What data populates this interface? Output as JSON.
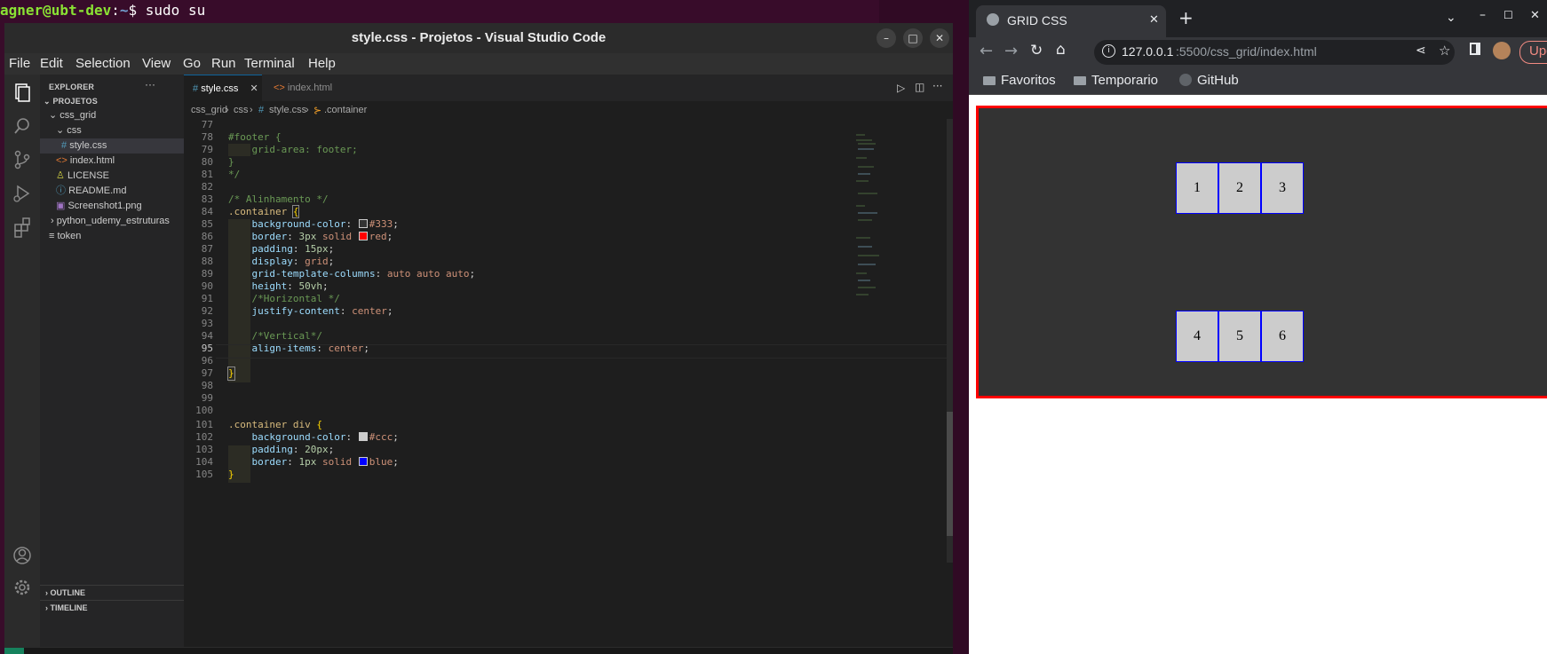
{
  "terminal": {
    "user": "agner@ubt-dev",
    "path": "~",
    "prompt_tail": "$ sudo su"
  },
  "vscode": {
    "title": "style.css - Projetos - Visual Studio Code",
    "menu": [
      "File",
      "Edit",
      "Selection",
      "View",
      "Go",
      "Run",
      "Terminal",
      "Help"
    ],
    "explorer_title": "EXPLORER",
    "workspace": "PROJETOS",
    "tree": [
      {
        "label": "css_grid",
        "kind": "folder-open"
      },
      {
        "label": "css",
        "kind": "folder-open"
      },
      {
        "label": "style.css",
        "kind": "css"
      },
      {
        "label": "index.html",
        "kind": "html"
      },
      {
        "label": "LICENSE",
        "kind": "license"
      },
      {
        "label": "README.md",
        "kind": "md"
      },
      {
        "label": "Screenshot1.png",
        "kind": "img"
      },
      {
        "label": "python_udemy_estruturas",
        "kind": "folder-closed"
      },
      {
        "label": "token",
        "kind": "file"
      }
    ],
    "outline_label": "OUTLINE",
    "timeline_label": "TIMELINE",
    "tabs": [
      {
        "label": "style.css",
        "icon": "#",
        "active": true
      },
      {
        "label": "index.html",
        "icon": "<>",
        "active": false
      }
    ],
    "breadcrumb": [
      "css_grid",
      "css",
      "style.css",
      ".container"
    ],
    "lines": [
      {
        "n": "77",
        "code": ""
      },
      {
        "n": "78",
        "code": "#footer {"
      },
      {
        "n": "79",
        "code": "    grid-area: footer;"
      },
      {
        "n": "80",
        "code": "}"
      },
      {
        "n": "81",
        "code": "*/"
      },
      {
        "n": "82",
        "code": ""
      },
      {
        "n": "83",
        "code": "/* Alinhamento */"
      },
      {
        "n": "84",
        "code": ".container {"
      },
      {
        "n": "85",
        "code": "    background-color: #333;"
      },
      {
        "n": "86",
        "code": "    border: 3px solid red;"
      },
      {
        "n": "87",
        "code": "    padding: 15px;"
      },
      {
        "n": "88",
        "code": "    display: grid;"
      },
      {
        "n": "89",
        "code": "    grid-template-columns: auto auto auto;"
      },
      {
        "n": "90",
        "code": "    height: 50vh;"
      },
      {
        "n": "91",
        "code": "    /*Horizontal */"
      },
      {
        "n": "92",
        "code": "    justify-content: center;"
      },
      {
        "n": "93",
        "code": ""
      },
      {
        "n": "94",
        "code": "    /*Vertical*/"
      },
      {
        "n": "95",
        "code": "    align-items: center;"
      },
      {
        "n": "96",
        "code": ""
      },
      {
        "n": "97",
        "code": "}"
      },
      {
        "n": "98",
        "code": ""
      },
      {
        "n": "99",
        "code": ""
      },
      {
        "n": "100",
        "code": ""
      },
      {
        "n": "101",
        "code": ".container div {"
      },
      {
        "n": "102",
        "code": "    background-color: #ccc;"
      },
      {
        "n": "103",
        "code": "    padding: 20px;"
      },
      {
        "n": "104",
        "code": "    border: 1px solid blue;"
      },
      {
        "n": "105",
        "code": "}"
      }
    ],
    "current_line": "95"
  },
  "chrome": {
    "tab_title": "GRID CSS",
    "url_host": "127.0.0.1",
    "url_rest": ":5500/css_grid/index.html",
    "update_label": "Update",
    "bookmarks": [
      "Favoritos",
      "Temporario",
      "GitHub"
    ],
    "grid_items": [
      "1",
      "2",
      "3",
      "4",
      "5",
      "6"
    ]
  },
  "colors": {
    "container_bg": "#333333",
    "container_border": "#ff0000",
    "cell_bg": "#cccccc",
    "cell_border": "#0000ff"
  }
}
